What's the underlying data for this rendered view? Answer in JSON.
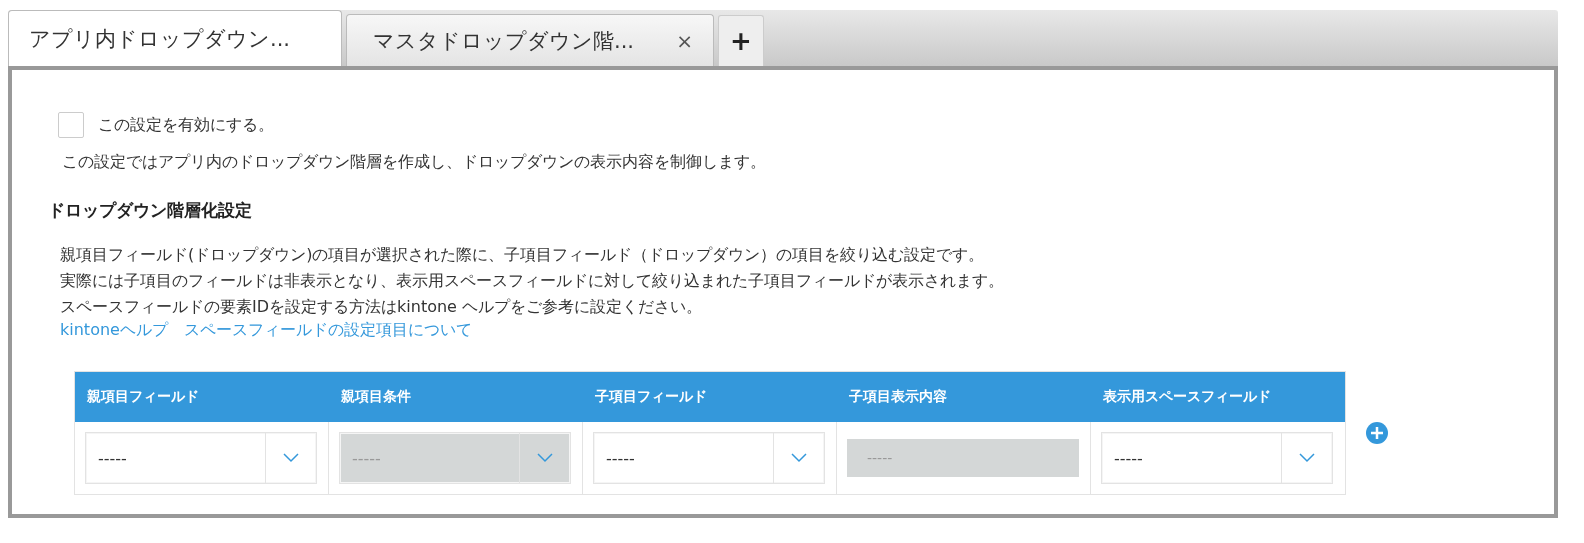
{
  "tabs": [
    {
      "label": "アプリ内ドロップダウン...",
      "selected": true,
      "closable": false
    },
    {
      "label": "マスタドロップダウン階...",
      "selected": false,
      "closable": true
    }
  ],
  "tab_close": "×",
  "add_tab": "+",
  "enable": {
    "label": "この設定を有効にする。",
    "checked": false
  },
  "intro": "この設定ではアプリ内のドロップダウン階層を作成し、ドロップダウンの表示内容を制御します。",
  "section_title": "ドロップダウン階層化設定",
  "description": [
    "親項目フィールド(ドロップダウン)の項目が選択された際に、子項目フィールド（ドロップダウン）の項目を絞り込む設定です。",
    "実際には子項目のフィールドは非表示となり、表示用スペースフィールドに対して絞り込まれた子項目フィールドが表示されます。",
    "スペースフィールドの要素IDを設定する方法はkintone ヘルプをご参考に設定ください。"
  ],
  "help_link": "kintoneヘルプ　スペースフィールドの設定項目について",
  "table": {
    "columns": [
      "親項目フィールド",
      "親項目条件",
      "子項目フィールド",
      "子項目表示内容",
      "表示用スペースフィールド"
    ],
    "rows": [
      [
        {
          "kind": "select",
          "value": "-----",
          "disabled": false
        },
        {
          "kind": "select",
          "value": "-----",
          "disabled": true
        },
        {
          "kind": "select",
          "value": "-----",
          "disabled": false
        },
        {
          "kind": "text",
          "value": "-----",
          "disabled": true
        },
        {
          "kind": "select",
          "value": "-----",
          "disabled": false
        }
      ]
    ]
  }
}
